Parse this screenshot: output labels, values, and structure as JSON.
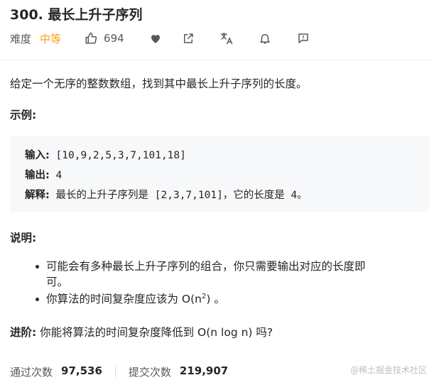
{
  "problem": {
    "title": "300. 最长上升子序列",
    "difficulty_label": "难度",
    "difficulty": "中等",
    "likes": "694",
    "colors": {
      "difficulty": "#ff9f1a",
      "text": "#262626",
      "muted": "#595959",
      "example_bg": "#f7f8fa"
    },
    "icons": [
      "thumbs-up-icon",
      "heart-icon",
      "share-icon",
      "translate-icon",
      "bell-icon",
      "feedback-icon"
    ]
  },
  "description": "给定一个无序的整数数组，找到其中最长上升子序列的长度。",
  "example": {
    "heading": "示例:",
    "input_label": "输入:",
    "input_value": " [10,9,2,5,3,7,101,18]",
    "output_label": "输出:",
    "output_value": " 4",
    "explain_label": "解释:",
    "explain_value": " 最长的上升子序列是 [2,3,7,101]，它的长度是 4。"
  },
  "notes": {
    "heading": "说明:",
    "item1_line1": "可能会有多种最长上升子序列的组合，你只需要输出对应的长度即",
    "item1_line2": "可。",
    "item2_prefix": "你算法的时间复杂度应该为 O(n",
    "item2_sup": "2",
    "item2_suffix": ") 。"
  },
  "advanced": {
    "label": "进阶:",
    "text": " 你能将算法的时间复杂度降低到 O(n log n) 吗?"
  },
  "stats": {
    "accepted_label": "通过次数",
    "accepted_value": "97,536",
    "submitted_label": "提交次数",
    "submitted_value": "219,907"
  },
  "watermark": "@稀土掘金技术社区"
}
